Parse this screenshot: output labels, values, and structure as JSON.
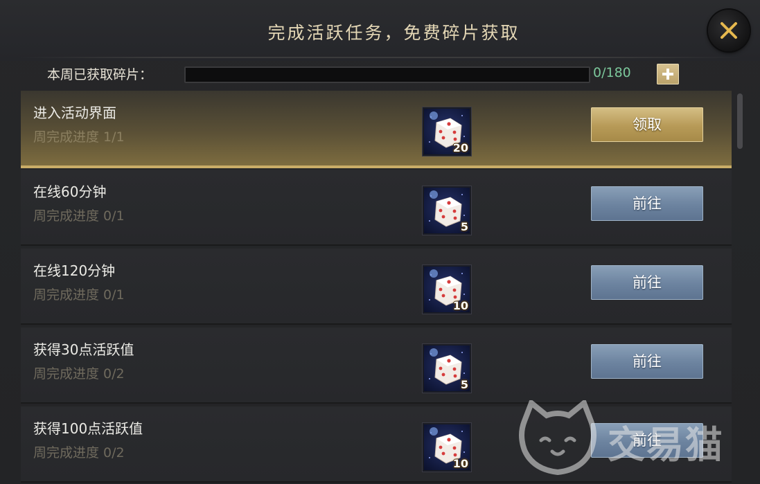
{
  "title": "完成活跃任务，免费碎片获取",
  "weekly": {
    "label": "本周已获取碎片：",
    "count": "0/180",
    "progress": 0
  },
  "tasks": [
    {
      "name": "进入活动界面",
      "progress": "周完成进度 1/1",
      "reward": "20",
      "button": "领取",
      "state": "claim"
    },
    {
      "name": "在线60分钟",
      "progress": "周完成进度 0/1",
      "reward": "5",
      "button": "前往",
      "state": "go"
    },
    {
      "name": "在线120分钟",
      "progress": "周完成进度 0/1",
      "reward": "10",
      "button": "前往",
      "state": "go"
    },
    {
      "name": "获得30点活跃值",
      "progress": "周完成进度 0/2",
      "reward": "5",
      "button": "前往",
      "state": "go"
    },
    {
      "name": "获得100点活跃值",
      "progress": "周完成进度 0/2",
      "reward": "10",
      "button": "前往",
      "state": "go"
    }
  ],
  "watermark": "交易猫",
  "colors": {
    "accent_gold": "#c9ad67",
    "go_button": "#6c839f",
    "progress_text": "#7cc79b"
  },
  "icons": {
    "close": "close-icon",
    "plus": "plus-icon",
    "reward": "dice-fragment-icon"
  }
}
